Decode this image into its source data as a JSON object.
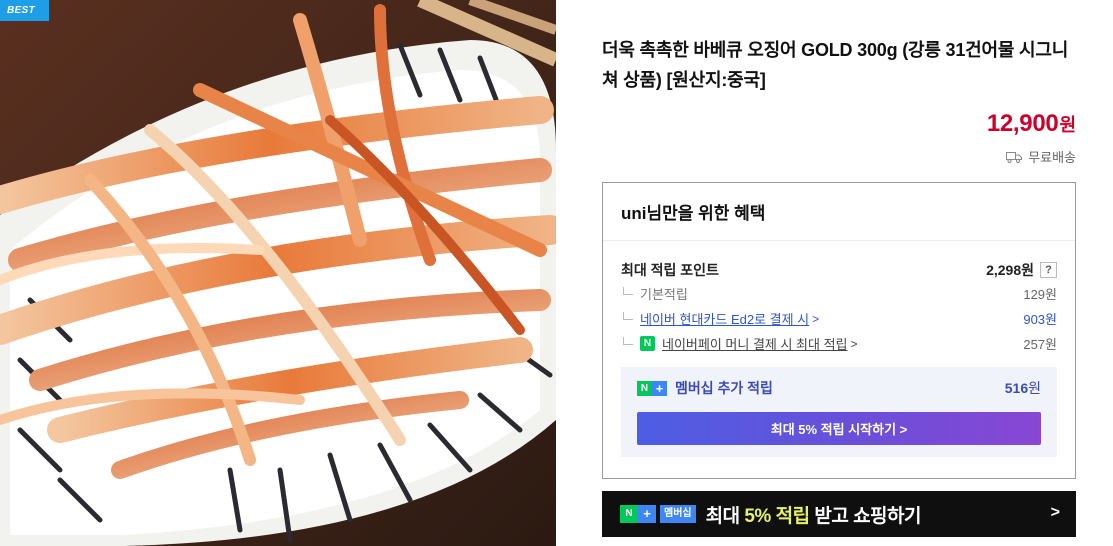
{
  "badge": {
    "label": "BEST"
  },
  "product": {
    "title": "더욱 촉촉한 바베큐 오징어 GOLD 300g (강릉 31건어물 시그니쳐 상품) [원산지:중국]",
    "price": "12,900",
    "price_unit": "원",
    "shipping": "무료배송",
    "shipping_icon": "truck-icon"
  },
  "benefit": {
    "heading": "uni님만을 위한 혜택",
    "max_label": "최대 적립 포인트",
    "max_value": "2,298원",
    "help_label": "?",
    "rows": [
      {
        "label": "기본적립",
        "amount": "129원"
      },
      {
        "label": "네이버 현대카드 Ed2로 결제 시",
        "chevron": ">",
        "amount": "903원"
      },
      {
        "badge": "N",
        "label": "네이버페이 머니 결제 시 최대 적립",
        "chevron": ">",
        "amount": "257원"
      }
    ],
    "member": {
      "badge_n": "N",
      "badge_plus": "+",
      "label": "멤버십 추가 적립",
      "amount": "516",
      "unit": "원",
      "button": "최대 5% 적립 시작하기 >"
    }
  },
  "banner": {
    "badge_n": "N",
    "badge_plus": "+",
    "badge_text": "멤버십",
    "text_pre": "최대 ",
    "text_highlight": "5% 적립",
    "text_post": " 받고 쇼핑하기",
    "arrow": ">"
  },
  "colors": {
    "price": "#cc0029",
    "link": "#2e55cf",
    "member_text": "#3c4ab8",
    "naver_green": "#03c75a",
    "badge_blue": "#1e9ee6"
  }
}
